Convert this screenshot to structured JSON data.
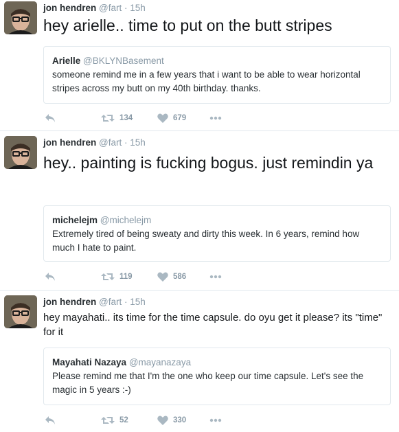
{
  "colors": {
    "icon_gray": "#aab8c2",
    "count_gray": "#8899a6",
    "border": "#e1e8ed"
  },
  "tweets": [
    {
      "author_name": "jon hendren",
      "author_handle": "@fart",
      "time": "15h",
      "text": "hey arielle.. time to put on the butt stripes",
      "quote": {
        "name": "Arielle",
        "handle": "@BKLYNBasement",
        "text": "someone remind me in a few years that i want to be able to wear horizontal stripes across my butt on my 40th birthday. thanks."
      },
      "retweets": "134",
      "likes": "679"
    },
    {
      "author_name": "jon hendren",
      "author_handle": "@fart",
      "time": "15h",
      "text": "hey.. painting is fucking bogus. just remindin ya",
      "quote": {
        "name": "michelejm",
        "handle": "@michelejm",
        "text": "Extremely tired of being sweaty and dirty this week. In 6 years, remind how much I hate to paint."
      },
      "retweets": "119",
      "likes": "586"
    },
    {
      "author_name": "jon hendren",
      "author_handle": "@fart",
      "time": "15h",
      "text": "hey mayahati.. its time for the time capsule. do oyu get it please? its \"time\" for it",
      "quote": {
        "name": "Mayahati Nazaya",
        "handle": "@mayanazaya",
        "text": "Please remind me that I'm the one who keep our time capsule. Let's see the magic in 5 years :-)"
      },
      "retweets": "52",
      "likes": "330"
    }
  ],
  "icons": {
    "reply": "reply-icon",
    "retweet": "retweet-icon",
    "like": "heart-icon",
    "more": "more-icon"
  }
}
